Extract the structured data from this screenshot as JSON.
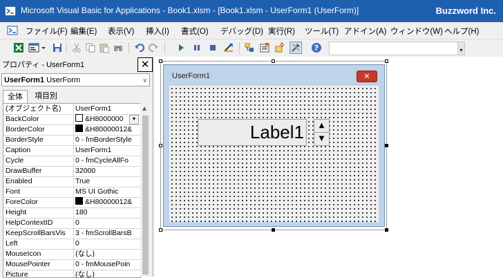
{
  "window": {
    "title": "Microsoft Visual Basic for Applications - Book1.xlsm - [Book1.xlsm - UserForm1 (UserForm)]",
    "brand": "Buzzword Inc."
  },
  "menu": {
    "items": [
      {
        "label": "ファイル(F)"
      },
      {
        "label": "編集(E)"
      },
      {
        "label": "表示(V)"
      },
      {
        "label": "挿入(I)"
      },
      {
        "label": "書式(O)"
      },
      {
        "label": "デバッグ(D)"
      },
      {
        "label": "実行(R)"
      },
      {
        "label": "ツール(T)"
      },
      {
        "label": "アドイン(A)"
      },
      {
        "label": "ウィンドウ(W)"
      },
      {
        "label": "ヘルプ(H)"
      }
    ]
  },
  "toolbar": {
    "buttons": [
      "view-excel-icon",
      "insert-userform-icon",
      "dropdown-arrow-icon",
      "save-icon",
      "cut-icon",
      "copy-icon",
      "paste-icon",
      "find-icon",
      "undo-icon",
      "redo-icon",
      "run-icon",
      "break-icon",
      "reset-icon",
      "design-mode-icon",
      "project-explorer-icon",
      "properties-window-icon",
      "object-browser-icon",
      "toolbox-icon",
      "help-icon"
    ]
  },
  "properties": {
    "title": "プロパティ - UserForm1",
    "close": "✕",
    "object_name": "UserForm1",
    "object_type": "UserForm",
    "tabs": [
      "全体",
      "項目別"
    ],
    "rows": [
      {
        "name": "(オブジェクト名)",
        "value": "UserForm1"
      },
      {
        "name": "BackColor",
        "value": "&H8000000",
        "swatch": "#ffffff",
        "dropdown": true
      },
      {
        "name": "BorderColor",
        "value": "&H80000012&",
        "swatch": "#000000"
      },
      {
        "name": "BorderStyle",
        "value": "0 - fmBorderStyle"
      },
      {
        "name": "Caption",
        "value": "UserForm1"
      },
      {
        "name": "Cycle",
        "value": "0 - fmCycleAllFo"
      },
      {
        "name": "DrawBuffer",
        "value": "32000"
      },
      {
        "name": "Enabled",
        "value": "True"
      },
      {
        "name": "Font",
        "value": "MS UI Gothic"
      },
      {
        "name": "ForeColor",
        "value": "&H80000012&",
        "swatch": "#000000"
      },
      {
        "name": "Height",
        "value": "180"
      },
      {
        "name": "HelpContextID",
        "value": "0"
      },
      {
        "name": "KeepScrollBarsVis",
        "value": "3 - fmScrollBarsB"
      },
      {
        "name": "Left",
        "value": "0"
      },
      {
        "name": "MouseIcon",
        "value": "(なし)"
      },
      {
        "name": "MousePointer",
        "value": "0 - fmMousePoin"
      },
      {
        "name": "Picture",
        "value": "(なし)"
      }
    ]
  },
  "form": {
    "caption": "UserForm1",
    "close": "✕",
    "label": "Label1",
    "spin_up": "▲",
    "spin_down": "▼"
  },
  "colors": {
    "titlebar": "#1f5fb0",
    "form_frame": "#bfd3ea",
    "close_button": "#c7392b"
  }
}
